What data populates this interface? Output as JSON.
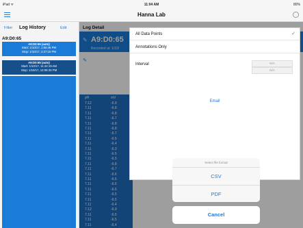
{
  "status_bar": {
    "left": "iPad ᯤ",
    "time": "11:04 AM",
    "battery": "80%"
  },
  "nav": {
    "title": "Hanna Lab"
  },
  "sidebar": {
    "filter_label": "Filter",
    "title": "Log History",
    "edit_label": "Edit",
    "device": "A9:D0:65",
    "logs": [
      {
        "title": "A9:D0:65 (auto)",
        "start": "Start: 1/10/17, 1:55:46 PM",
        "stop": "Stop: 1/10/17, 2:27:15 PM"
      },
      {
        "title": "A9:D0:65 (auto)",
        "start": "Start: 1/10/17, 11:42:19 AM",
        "stop": "Stop: 1/10/17, 12:08:33 PM"
      }
    ]
  },
  "detail": {
    "label": "Log Detail",
    "device_name": "A9:D0:65",
    "recorded": "Recorded at: 1/10/",
    "table": {
      "headers": [
        "pH",
        "mV"
      ],
      "rows": [
        [
          "7.12",
          "-6.9"
        ],
        [
          "7.11",
          "-6.8"
        ],
        [
          "7.11",
          "-6.8"
        ],
        [
          "7.11",
          "-6.7"
        ],
        [
          "7.11",
          "-6.8"
        ],
        [
          "7.11",
          "-6.8"
        ],
        [
          "7.11",
          "-6.7"
        ],
        [
          "7.11",
          "-6.5"
        ],
        [
          "7.11",
          "-6.4"
        ],
        [
          "7.11",
          "-6.3"
        ],
        [
          "7.11",
          "-6.5"
        ],
        [
          "7.11",
          "-6.5"
        ],
        [
          "7.11",
          "-6.8"
        ],
        [
          "7.11",
          "-6.7"
        ],
        [
          "7.11",
          "-6.6"
        ],
        [
          "7.11",
          "-6.5"
        ],
        [
          "7.11",
          "-6.6"
        ],
        [
          "7.11",
          "-6.5"
        ],
        [
          "7.11",
          "-6.5"
        ],
        [
          "7.11",
          "-6.5"
        ],
        [
          "7.11",
          "-6.4"
        ],
        [
          "7.12",
          "-6.9"
        ],
        [
          "7.11",
          "-6.5"
        ],
        [
          "7.11",
          "-6.5"
        ],
        [
          "7.11",
          "-6.4"
        ]
      ]
    }
  },
  "popover": {
    "all_data_points": "All Data Points",
    "annotations_only": "Annotations Only",
    "interval_label": "Interval",
    "interval_values": [
      "N/A",
      "N/A"
    ],
    "email_label": "Email"
  },
  "action_sheet": {
    "title": "Select file format",
    "csv_label": "CSV",
    "pdf_label": "PDF",
    "cancel_label": "Cancel"
  }
}
